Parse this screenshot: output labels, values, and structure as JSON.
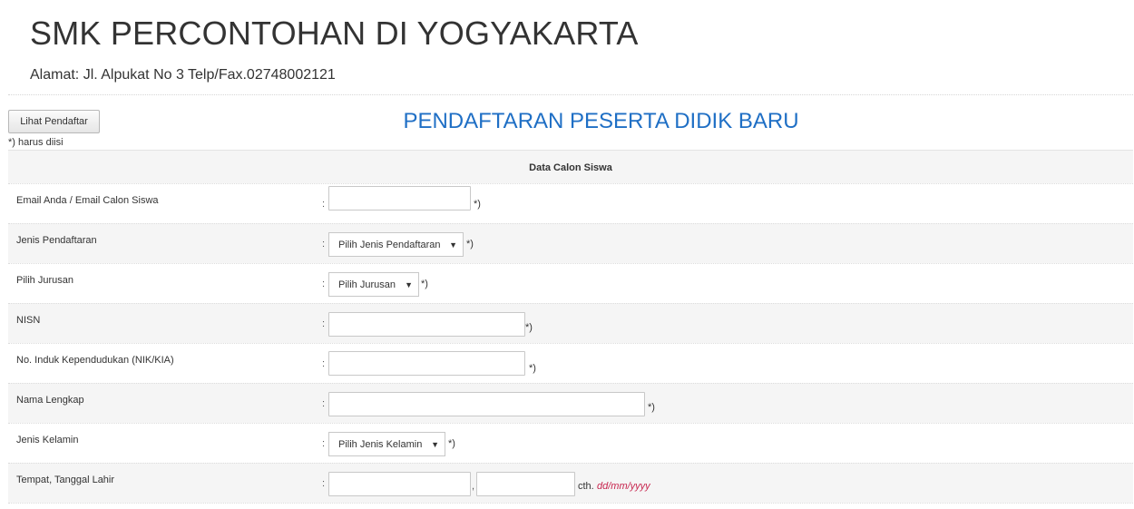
{
  "header": {
    "school_name": "SMK PERCONTOHAN DI YOGYAKARTA",
    "address": "Alamat: Jl. Alpukat No 3 Telp/Fax.02748002121"
  },
  "toolbar": {
    "view_button_label": "Lihat Pendaftar"
  },
  "form": {
    "title": "PENDAFTARAN PESERTA DIDIK BARU",
    "required_note": "*) harus diisi",
    "section_title": "Data Calon Siswa",
    "colon": ":",
    "required_mark": "*)",
    "fields": {
      "email": {
        "label": "Email Anda / Email Calon Siswa",
        "value": ""
      },
      "registration_type": {
        "label": "Jenis Pendaftaran",
        "selected": "Pilih Jenis Pendaftaran"
      },
      "major": {
        "label": "Pilih Jurusan",
        "selected": "Pilih Jurusan"
      },
      "nisn": {
        "label": "NISN",
        "value": ""
      },
      "nik": {
        "label": "No. Induk Kependudukan (NIK/KIA)",
        "value": ""
      },
      "full_name": {
        "label": "Nama Lengkap",
        "value": ""
      },
      "gender": {
        "label": "Jenis Kelamin",
        "selected": "Pilih Jenis Kelamin"
      },
      "birth": {
        "label": "Tempat, Tanggal Lahir",
        "place_value": "",
        "date_value": "",
        "separator": ",",
        "hint_prefix": "cth.",
        "hint_format": "dd/mm/yyyy"
      }
    },
    "dropdown_icon": "caret-down-icon"
  },
  "colors": {
    "title": "#1f6fc5",
    "hint": "#c7254e",
    "row_alt": "#f5f5f5"
  }
}
